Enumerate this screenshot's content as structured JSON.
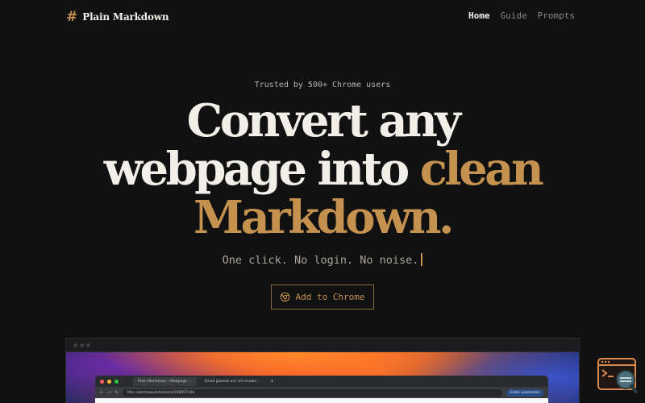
{
  "brand": {
    "symbol": "#",
    "name": "Plain Markdown"
  },
  "nav": {
    "links": [
      {
        "label": "Home",
        "active": true
      },
      {
        "label": "Guide",
        "active": false
      },
      {
        "label": "Prompts",
        "active": false
      }
    ]
  },
  "hero": {
    "trusted": "Trusted by 500+ Chrome users",
    "line1": "Convert any",
    "line2_plain": "webpage into",
    "line2_accent": "clean",
    "line3_accent": "Markdown.",
    "tagline": "One click. No login. No noise.",
    "cta_label": "Add to Chrome"
  },
  "preview": {
    "tabs": [
      "Plain Markdown | Webpage ...",
      "Small glasses are 'all visuals'..."
    ],
    "url": "fdsc.com/news/articles/s3106957e0o",
    "extension_label": "Enter username"
  },
  "colors": {
    "background": "#111112",
    "text": "#f2efe9",
    "accent": "#c4914f",
    "muted": "#8a8782"
  },
  "icons": {
    "brand": "hash-icon",
    "cta": "chrome-icon",
    "helper": "terminal-search-icon"
  }
}
